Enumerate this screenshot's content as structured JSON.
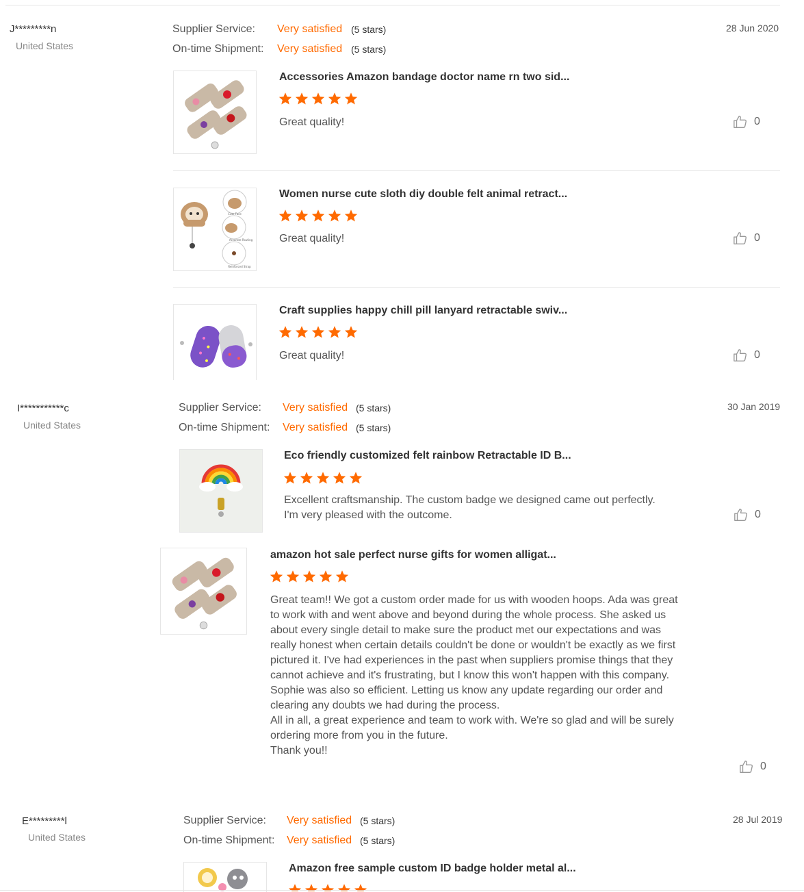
{
  "colors": {
    "accent": "#ff6a00",
    "divider": "#e5e5e5"
  },
  "labels": {
    "supplier_service": "Supplier Service:",
    "ontime_shipment": "On-time Shipment:"
  },
  "reviews": [
    {
      "user": "J*********n",
      "country": "United States",
      "date": "28 Jun 2020",
      "supplier_service": {
        "rating": "Very satisfied",
        "stars": "(5 stars)"
      },
      "ontime_shipment": {
        "rating": "Very satisfied",
        "stars": "(5 stars)"
      },
      "products": [
        {
          "title": "Accessories Amazon bandage doctor name rn two sid...",
          "stars": 5,
          "text": "Great quality!",
          "likes": "0",
          "image_icon": "bandage-badge-image"
        },
        {
          "title": "Women nurse cute sloth diy double felt animal retract...",
          "stars": 5,
          "text": "Great quality!",
          "likes": "0",
          "image_icon": "sloth-badge-image",
          "image_labels": [
            "Cute Face",
            "Accurate Routing",
            "Reinforced Strap"
          ]
        },
        {
          "title": "Craft supplies happy chill pill lanyard retractable swiv...",
          "stars": 5,
          "text": "Great quality!",
          "likes": "0",
          "image_icon": "pill-badge-image"
        }
      ]
    },
    {
      "user": "I***********c",
      "country": "United States",
      "date": "30 Jan 2019",
      "supplier_service": {
        "rating": "Very satisfied",
        "stars": "(5 stars)"
      },
      "ontime_shipment": {
        "rating": "Very satisfied",
        "stars": "(5 stars)"
      },
      "products": [
        {
          "title": "Eco friendly customized felt rainbow Retractable ID B...",
          "stars": 5,
          "text": "Excellent craftsmanship. The custom badge we designed came out perfectly.\nI'm very pleased with the outcome.",
          "likes": "0",
          "image_icon": "rainbow-badge-image"
        },
        {
          "title": "amazon hot sale perfect nurse gifts for women alligat...",
          "stars": 5,
          "text": "Great team!! We got a custom order made for us with wooden hoops. Ada was great to work with and went above and beyond during the whole process. She asked us about every single detail to make sure the product met our expectations and was really honest when certain details couldn't be done or wouldn't be exactly as we first pictured it. I've had experiences in the past when suppliers promise things that they cannot achieve and it's frustrating, but I know this won't happen with this company.\nSophie was also so efficient. Letting us know any update regarding our order and clearing any doubts we had during the process.\nAll in all, a great experience and team to work with. We're so glad and will be surely ordering more from you in the future.\nThank you!!",
          "likes": "0",
          "image_icon": "bandage-badge-image"
        }
      ]
    },
    {
      "user": "E*********l",
      "country": "United States",
      "date": "28 Jul 2019",
      "supplier_service": {
        "rating": "Very satisfied",
        "stars": "(5 stars)"
      },
      "ontime_shipment": {
        "rating": "Very satisfied",
        "stars": "(5 stars)"
      },
      "products": [
        {
          "title": "Amazon free sample custom ID badge holder metal al...",
          "stars": 5,
          "image_icon": "animal-badges-image"
        }
      ]
    }
  ]
}
